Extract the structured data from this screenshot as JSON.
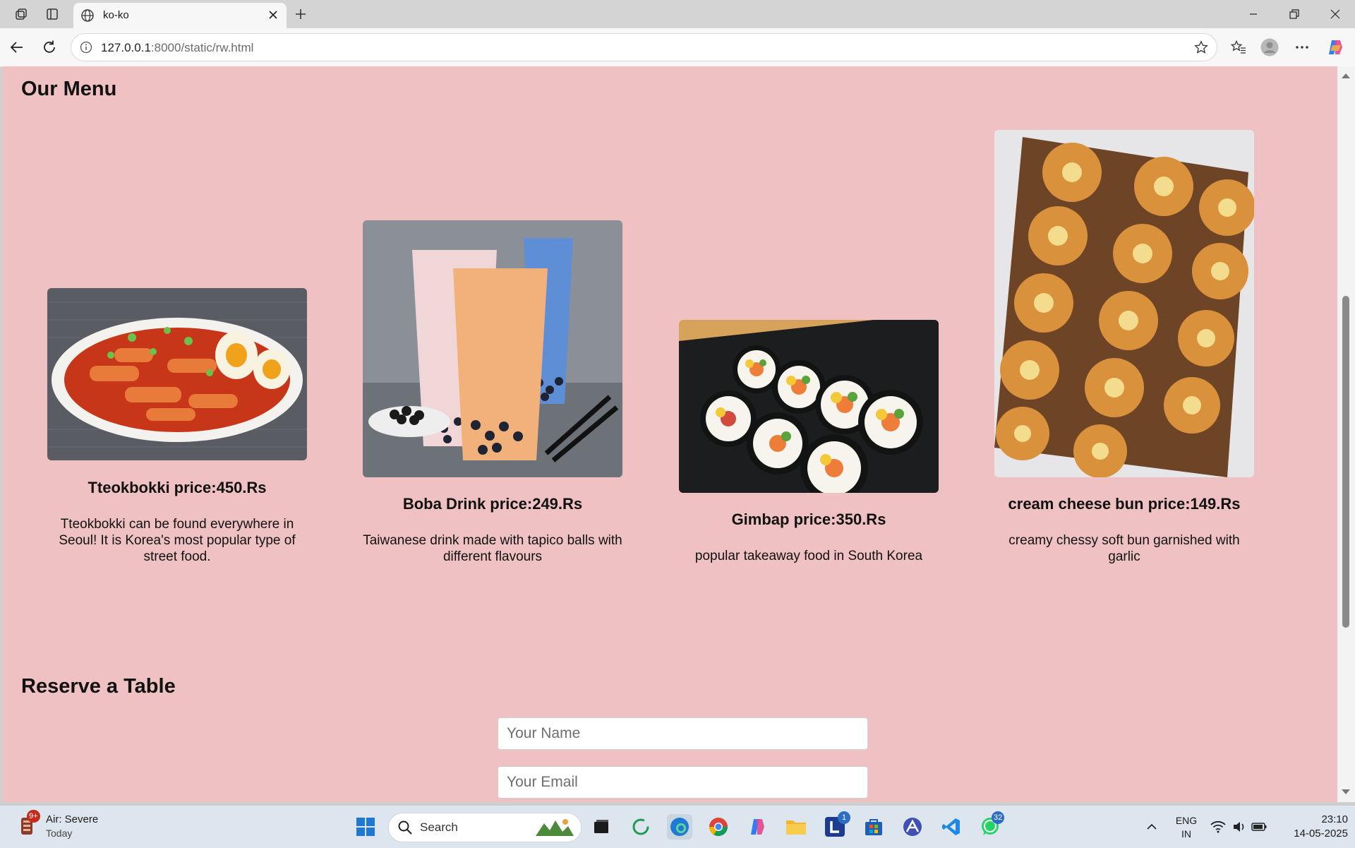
{
  "browser": {
    "tab_title": "ko-ko",
    "url_host": "127.0.0.1",
    "url_rest": ":8000/static/rw.html"
  },
  "page": {
    "menu_heading": "Our Menu",
    "menu_items": [
      {
        "name": "Tteokbokki price:450.Rs",
        "description": "Tteokbokki can be found everywhere in Seoul! It is Korea's most popular type of street food.",
        "image": "tteokbokki-photo"
      },
      {
        "name": "Boba Drink price:249.Rs",
        "description": "Taiwanese drink made with tapico balls with different flavours",
        "image": "boba-drink-photo"
      },
      {
        "name": "Gimbap price:350.Rs",
        "description": "popular takeaway food in South Korea",
        "image": "gimbap-photo"
      },
      {
        "name": "cream cheese bun price:149.Rs",
        "description": "creamy chessy soft bun garnished with garlic",
        "image": "cream-cheese-bun-photo"
      }
    ],
    "reserve_heading": "Reserve a Table",
    "form": {
      "name_placeholder": "Your Name",
      "email_placeholder": "Your Email"
    },
    "background_color": "#efc1c2"
  },
  "taskbar": {
    "weather_title": "Air: Severe",
    "weather_sub": "Today",
    "weather_badge": "9+",
    "search_label": "Search",
    "lang_top": "ENG",
    "lang_bottom": "IN",
    "time": "23:10",
    "date": "14-05-2025",
    "badge_l": "1",
    "badge_whatsapp": "32"
  }
}
